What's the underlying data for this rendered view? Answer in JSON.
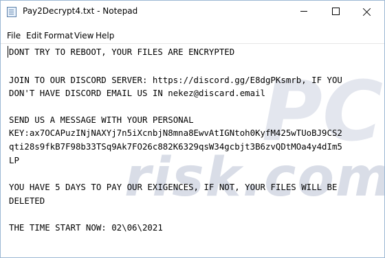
{
  "window": {
    "title": "Pay2Decrypt4.txt - Notepad",
    "minimize_icon": "minimize-icon",
    "maximize_icon": "maximize-icon",
    "close_icon": "close-icon"
  },
  "menu": {
    "items": [
      "File",
      "Edit",
      "Format",
      "View",
      "Help"
    ]
  },
  "editor": {
    "lines": [
      "DONT TRY TO REBOOT, YOUR FILES ARE ENCRYPTED",
      "",
      "JOIN TO OUR DISCORD SERVER: https://discord.gg/E8dgPKsmrb, IF YOU",
      "DON'T HAVE DISCORD EMAIL US IN nekez@discard.email",
      "",
      "SEND US A MESSAGE WITH YOUR PERSONAL",
      "KEY:ax7OCAPuzINjNAXYj7n5iXcnbjN8mna8EwvAtIGNtoh0KyfM425wTUoBJ9CS2",
      "qti28s9fkB7F98b33TSq9Ak7FO26c882K6329qsW34gcbjt3B6zvQDtMOa4y4dIm5",
      "LP",
      "",
      "YOU HAVE 5 DAYS TO PAY OUR EXIGENCES, IF NOT, YOUR FILES WILL BE",
      "DELETED",
      "",
      "THE TIME START NOW: 02\\06\\2021"
    ]
  },
  "watermark": {
    "text_a": "PC",
    "text_b": "risk.com"
  }
}
